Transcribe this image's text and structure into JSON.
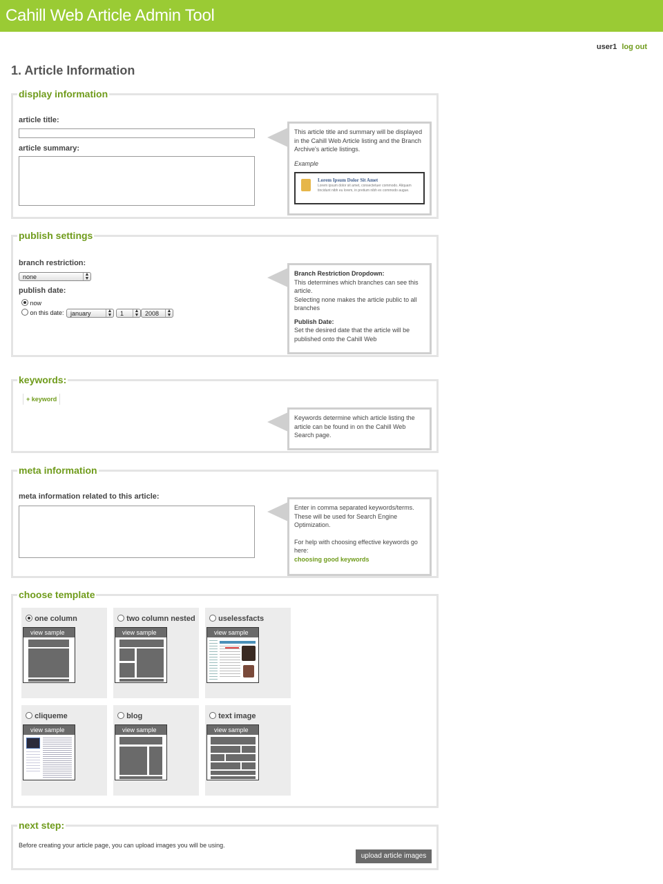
{
  "header": {
    "app_title": "Cahill Web Article Admin Tool"
  },
  "user": {
    "name": "user1",
    "logout_label": "log out"
  },
  "page_title": "1. Article Information",
  "display_info": {
    "legend": "display information",
    "title_label": "article title:",
    "summary_label": "article summary:",
    "title_value": "",
    "summary_value": "",
    "help_text": "This article title and summary will be displayed in the Cahill Web Article listing and the Branch Archive's article listings.",
    "example_label": "Example",
    "example_title": "Lorem Ipsum Dolor Sit Amet",
    "example_body": "Lorem ipsum dolor sit amet, consectetuer commodo. Aliquam tincidunt nibh eu lorem, in pretium nibh ex commodo augue."
  },
  "publish": {
    "legend": "publish settings",
    "branch_label": "branch restriction:",
    "branch_value": "none",
    "date_label": "publish date:",
    "now_label": "now",
    "on_date_label": "on this date:",
    "month": "january",
    "day": "1",
    "year": "2008",
    "help_title1": "Branch Restriction Dropdown:",
    "help_text1a": "This determines which branches can see this article.",
    "help_text1b": "Selecting none makes the article public to all branches",
    "help_title2": "Publish Date:",
    "help_text2": "Set the desired date that the article will be published onto the Cahill Web"
  },
  "keywords": {
    "legend": "keywords:",
    "add_label": "+ keyword",
    "help_text": "Keywords determine which article listing the article can be found in on the Cahill Web Search page."
  },
  "meta": {
    "legend": "meta information",
    "field_label": "meta information related to this article:",
    "value": "",
    "help_text1": "Enter in comma separated keywords/terms. These will be used for Search Engine Optimization.",
    "help_text2": "For help with choosing effective keywords go here:",
    "help_link": "choosing good keywords"
  },
  "template": {
    "legend": "choose template",
    "view_label": "view sample",
    "items": [
      {
        "name": "one column",
        "selected": true
      },
      {
        "name": "two column nested",
        "selected": false
      },
      {
        "name": "uselessfacts",
        "selected": false
      },
      {
        "name": "cliqueme",
        "selected": false
      },
      {
        "name": "blog",
        "selected": false
      },
      {
        "name": "text image",
        "selected": false
      }
    ]
  },
  "next": {
    "legend": "next step:",
    "text": "Before creating your article page, you can upload images you will be using.",
    "button_label": "upload article images"
  }
}
